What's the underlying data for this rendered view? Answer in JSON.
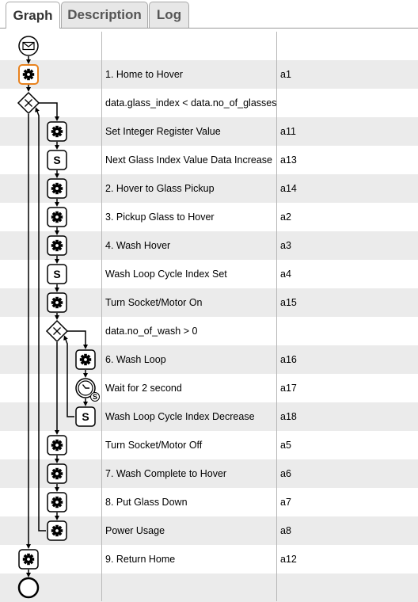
{
  "tabs": [
    "Graph",
    "Description",
    "Log"
  ],
  "rows": [
    {
      "name": "",
      "id": "",
      "icon": "mail-start-event-icon"
    },
    {
      "name": "1. Home to Hover",
      "id": "a1",
      "icon": "gear-icon"
    },
    {
      "name": "data.glass_index < data.no_of_glasses",
      "id": "",
      "icon": "exclusive-gateway-icon"
    },
    {
      "name": "Set Integer Register Value",
      "id": "a11",
      "icon": "gear-icon"
    },
    {
      "name": "Next Glass Index Value Data Increase",
      "id": "a13",
      "icon": "script-icon"
    },
    {
      "name": "2. Hover to Glass Pickup",
      "id": "a14",
      "icon": "gear-icon"
    },
    {
      "name": "3. Pickup Glass to Hover",
      "id": "a2",
      "icon": "gear-icon"
    },
    {
      "name": "4. Wash Hover",
      "id": "a3",
      "icon": "gear-icon"
    },
    {
      "name": "Wash Loop Cycle Index Set",
      "id": "a4",
      "icon": "script-icon"
    },
    {
      "name": "Turn Socket/Motor On",
      "id": "a15",
      "icon": "gear-icon"
    },
    {
      "name": "data.no_of_wash > 0",
      "id": "",
      "icon": "exclusive-gateway-icon"
    },
    {
      "name": "6. Wash Loop",
      "id": "a16",
      "icon": "gear-icon"
    },
    {
      "name": "Wait for 2 second",
      "id": "a17",
      "icon": "timer-icon"
    },
    {
      "name": "Wash Loop Cycle Index Decrease",
      "id": "a18",
      "icon": "script-icon"
    },
    {
      "name": "Turn Socket/Motor Off",
      "id": "a5",
      "icon": "gear-icon"
    },
    {
      "name": "7. Wash Complete to Hover",
      "id": "a6",
      "icon": "gear-icon"
    },
    {
      "name": "8. Put Glass Down",
      "id": "a7",
      "icon": "gear-icon"
    },
    {
      "name": "Power Usage",
      "id": "a8",
      "icon": "gear-icon"
    },
    {
      "name": "9. Return Home",
      "id": "a12",
      "icon": "gear-icon"
    },
    {
      "name": "",
      "id": "",
      "icon": "end-event-icon"
    }
  ],
  "script_letter": "S",
  "colors": {
    "selected_border": "#e8821e",
    "shade": "#ebebeb",
    "line": "#000000"
  }
}
